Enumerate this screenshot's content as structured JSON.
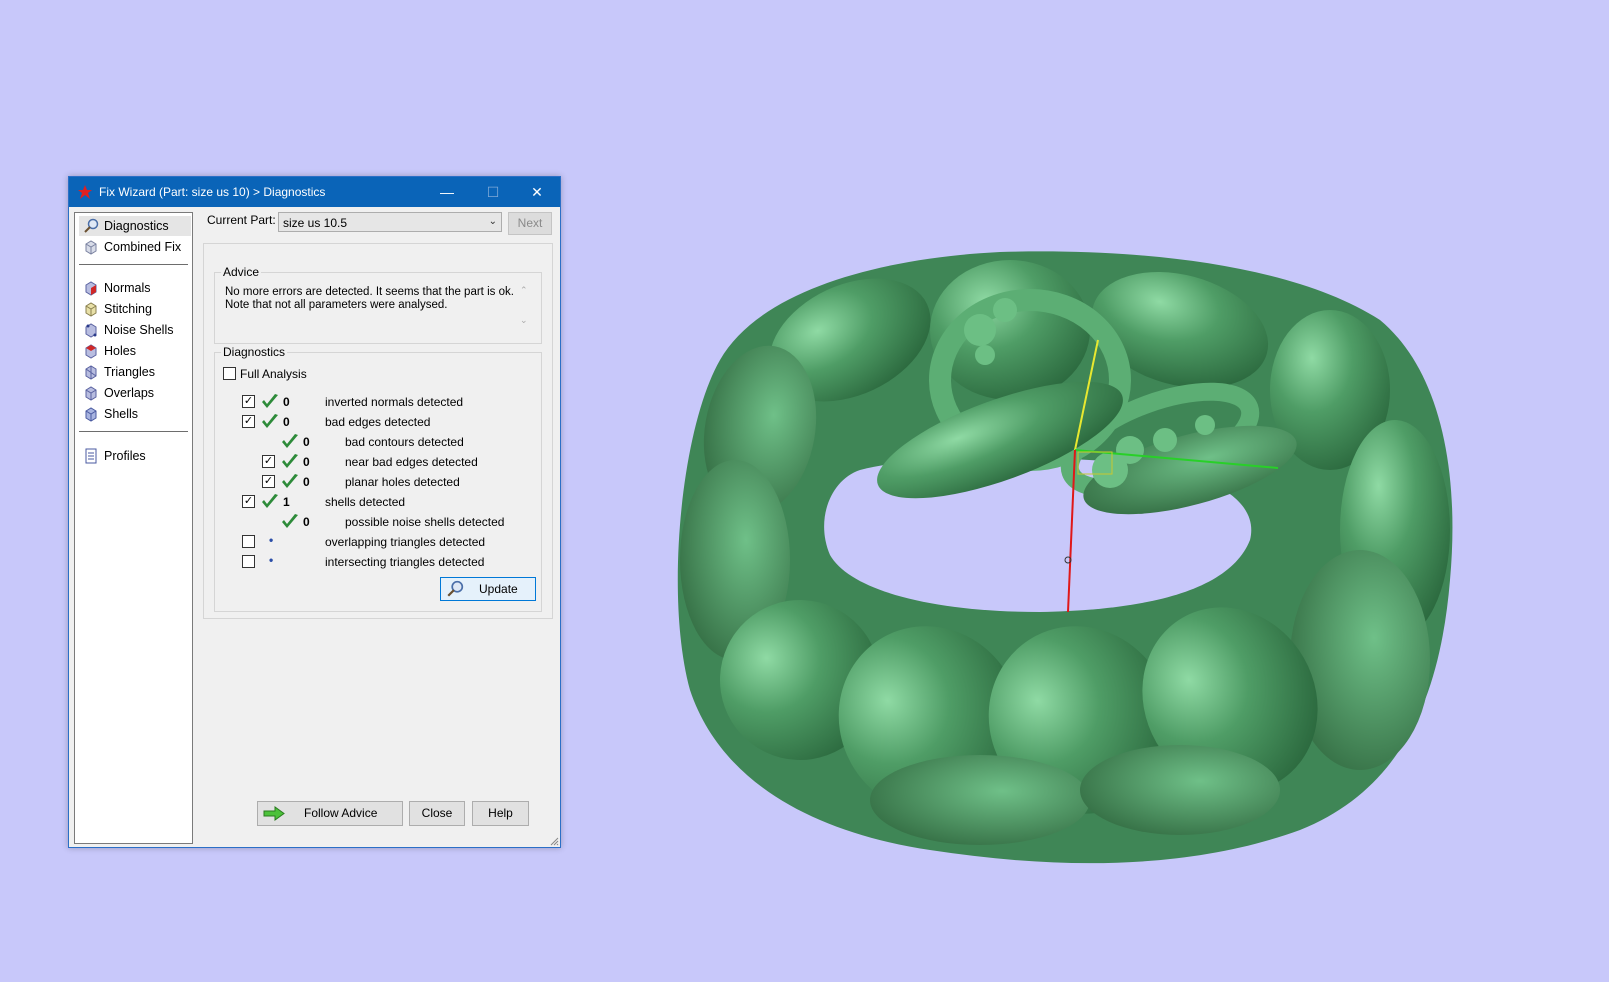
{
  "window": {
    "title": "Fix Wizard (Part: size us 10) > Diagnostics",
    "minimize_glyph": "—",
    "maximize_glyph": "☐",
    "close_glyph": "✕"
  },
  "nav": {
    "items": [
      {
        "label": "Diagnostics",
        "icon": "magnifier-icon",
        "selected": true
      },
      {
        "label": "Combined Fix",
        "icon": "cube-icon"
      },
      {
        "label": "Normals",
        "icon": "normals-cube-icon"
      },
      {
        "label": "Stitching",
        "icon": "stitching-cube-icon"
      },
      {
        "label": "Noise Shells",
        "icon": "noise-shells-icon"
      },
      {
        "label": "Holes",
        "icon": "holes-cube-icon"
      },
      {
        "label": "Triangles",
        "icon": "triangles-cube-icon"
      },
      {
        "label": "Overlaps",
        "icon": "overlaps-cube-icon"
      },
      {
        "label": "Shells",
        "icon": "shells-cube-icon"
      },
      {
        "label": "Profiles",
        "icon": "profiles-document-icon"
      }
    ]
  },
  "current_part": {
    "label": "Current Part:",
    "value": "size us 10.5",
    "next_label": "Next"
  },
  "advice": {
    "title": "Advice",
    "text": "No more errors are detected. It seems that the part is ok. Note that not all parameters were analysed."
  },
  "diagnostics": {
    "title": "Diagnostics",
    "full_analysis_label": "Full Analysis",
    "full_analysis_checked": false,
    "rows": [
      {
        "checkbox": true,
        "checked": true,
        "status": "ok",
        "count": "0",
        "text": "inverted normals detected",
        "indent": 0
      },
      {
        "checkbox": true,
        "checked": true,
        "status": "ok",
        "count": "0",
        "text": "bad edges detected",
        "indent": 0
      },
      {
        "checkbox": false,
        "checked": false,
        "status": "ok",
        "count": "0",
        "text": "bad contours detected",
        "indent": 1
      },
      {
        "checkbox": true,
        "checked": true,
        "status": "ok",
        "count": "0",
        "text": "near bad edges detected",
        "indent": 1
      },
      {
        "checkbox": true,
        "checked": true,
        "status": "ok",
        "count": "0",
        "text": "planar holes detected",
        "indent": 1
      },
      {
        "checkbox": true,
        "checked": true,
        "status": "ok",
        "count": "1",
        "text": "shells detected",
        "indent": 0
      },
      {
        "checkbox": false,
        "checked": false,
        "status": "ok",
        "count": "0",
        "text": "possible noise shells detected",
        "indent": 1
      },
      {
        "checkbox": true,
        "checked": false,
        "status": "none",
        "count": "•",
        "text": "overlapping triangles detected",
        "indent": 0
      },
      {
        "checkbox": true,
        "checked": false,
        "status": "none",
        "count": "•",
        "text": "intersecting triangles detected",
        "indent": 0
      }
    ],
    "update_label": "Update"
  },
  "buttons": {
    "follow_advice": "Follow Advice",
    "close": "Close",
    "help": "Help"
  },
  "colors": {
    "background": "#c8c8fa",
    "titlebar": "#0a64b8",
    "model": "#4e9a63",
    "check_green": "#2e8b3a"
  }
}
